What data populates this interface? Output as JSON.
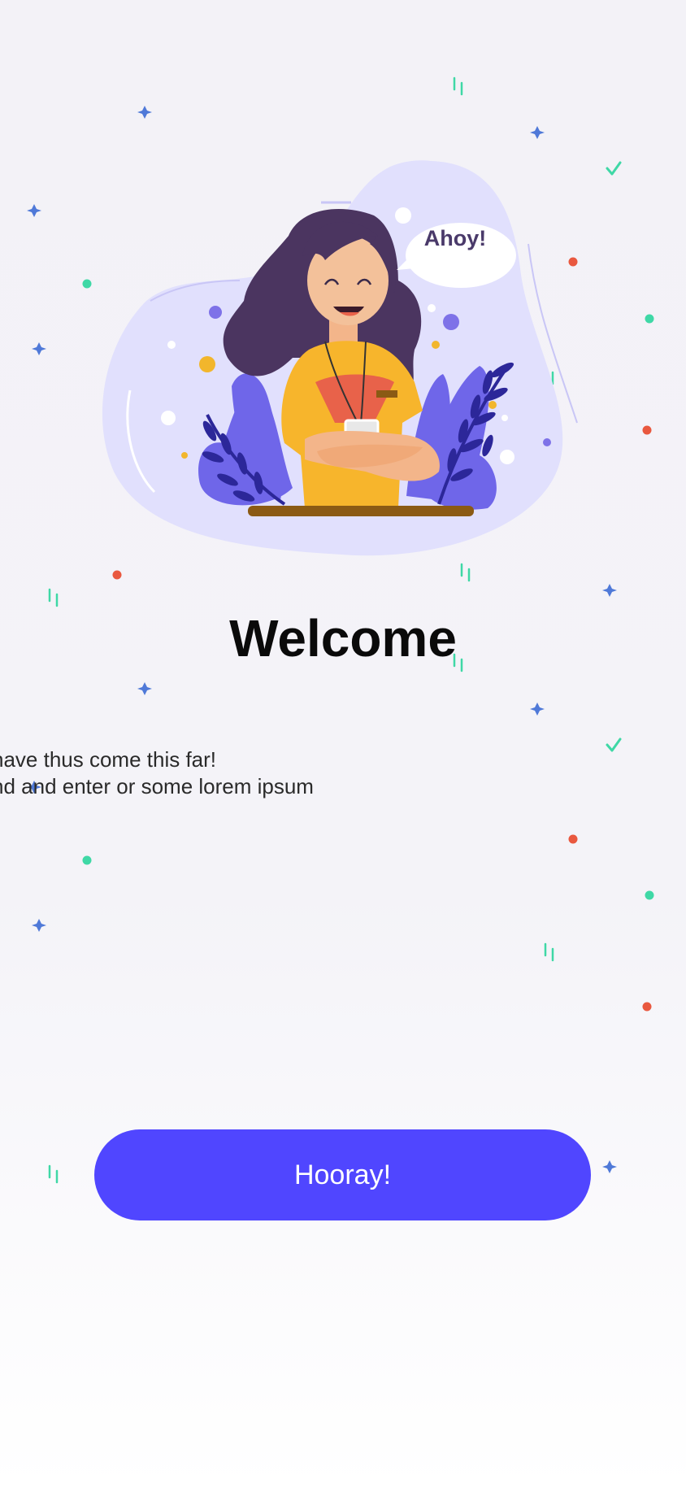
{
  "speech_bubble": {
    "text": "Ahoy!"
  },
  "welcome": {
    "title": "Welcome",
    "subtitle_line1": "have thus come this far!",
    "subtitle_line2": "nd and enter or some lorem ipsum"
  },
  "primary_button": {
    "label": "Hooray!"
  },
  "colors": {
    "accent": "#5046ff",
    "blob": "#e1e0fd",
    "hair": "#4b3560",
    "shirt": "#f7b52c",
    "leaf_light": "#6f66e9",
    "leaf_dark": "#2c2799",
    "confetti_red": "#e9583f",
    "confetti_green": "#3fd8a6",
    "confetti_blue": "#4f79d8"
  }
}
